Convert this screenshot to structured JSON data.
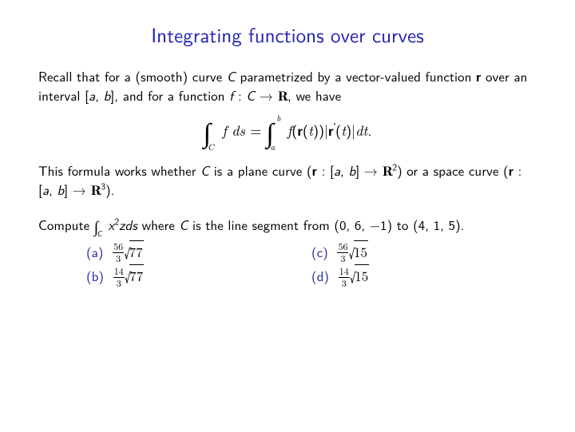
{
  "title": "Integrating functions over curves",
  "para1_a": "Recall that for a (smooth) curve ",
  "para1_C": "C",
  "para1_b": " parametrized by a vector-valued function ",
  "para1_r": "r",
  "para1_c": " over an interval [",
  "para1_a_var": "a",
  "para1_comma": ", ",
  "para1_b_var": "b",
  "para1_d": "], and for a function ",
  "para1_f": "f",
  "para1_e": " : ",
  "para1_C2": "C",
  "para1_arrow": " → ",
  "para1_R": "R",
  "para1_end": ", we have",
  "eq_C": "C",
  "eq_f": "f",
  "eq_ds": " ds ",
  "eq_eq": "= ",
  "eq_a": "a",
  "eq_b": "b",
  "eq_f2": "f",
  "eq_open": "(",
  "eq_r": "r",
  "eq_open2": "(",
  "eq_t": "t",
  "eq_close": "))|",
  "eq_r2": "r",
  "eq_prime": "′",
  "eq_open3": "(",
  "eq_t2": "t",
  "eq_close2": ")|",
  "eq_dt": "dt",
  "eq_period": ".",
  "para2_a": "This formula works whether ",
  "para2_C": "C",
  "para2_b": " is a plane curve (",
  "para2_r": "r",
  "para2_c": " : [",
  "para2_a_var": "a",
  "para2_comma": ", ",
  "para2_b_var": "b",
  "para2_d": "] → ",
  "para2_R": "R",
  "para2_sup2": "2",
  "para2_e": ") or a space curve (",
  "para2_r2": "r",
  "para2_f": " : [",
  "para2_a_var2": "a",
  "para2_comma2": ", ",
  "para2_b_var2": "b",
  "para2_g": "] → ",
  "para2_R2": "R",
  "para2_sup3": "3",
  "para2_h": ").",
  "para3_a": "Compute ",
  "para3_C": "C",
  "para3_x": "x",
  "para3_sup": "2",
  "para3_z": "z",
  "para3_ds": "ds",
  "para3_b": " where ",
  "para3_C2": "C",
  "para3_c": " is the line segment from (0, 6, −1) to (4, 1, 5).",
  "choices": {
    "a": {
      "label": "(a)",
      "num": "56",
      "den": "3",
      "rad": "77"
    },
    "b": {
      "label": "(b)",
      "num": "14",
      "den": "3",
      "rad": "77"
    },
    "c": {
      "label": "(c)",
      "num": "56",
      "den": "3",
      "rad": "15"
    },
    "d": {
      "label": "(d)",
      "num": "14",
      "den": "3",
      "rad": "15"
    }
  }
}
